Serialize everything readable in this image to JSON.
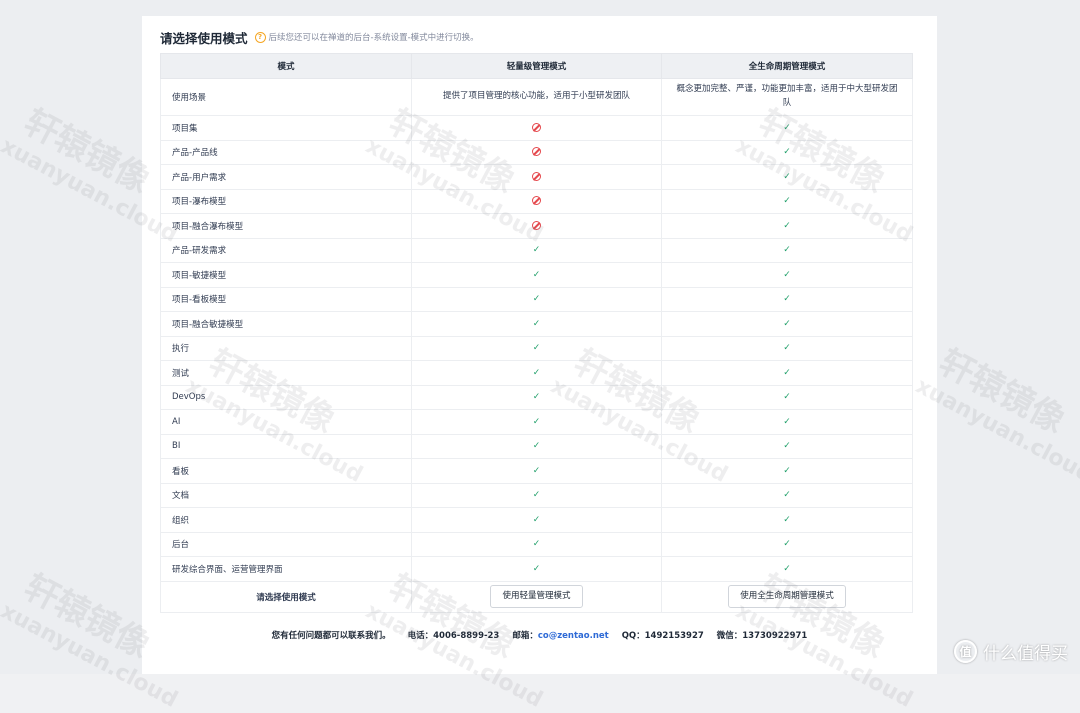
{
  "header": {
    "title": "请选择使用模式",
    "info_icon": "?",
    "hint": "后续您还可以在禅道的后台-系统设置-模式中进行切换。"
  },
  "table": {
    "columns": [
      "模式",
      "轻量级管理模式",
      "全生命周期管理模式"
    ],
    "scene": {
      "label": "使用场景",
      "light": "提供了项目管理的核心功能，适用于小型研发团队",
      "full": "概念更加完整、严谨，功能更加丰富，适用于中大型研发团队"
    },
    "rows": [
      {
        "feature": "项目集",
        "light": "no",
        "full": "yes"
      },
      {
        "feature": "产品-产品线",
        "light": "no",
        "full": "yes"
      },
      {
        "feature": "产品-用户需求",
        "light": "no",
        "full": "yes"
      },
      {
        "feature": "项目-瀑布模型",
        "light": "no",
        "full": "yes"
      },
      {
        "feature": "项目-融合瀑布模型",
        "light": "no",
        "full": "yes"
      },
      {
        "feature": "产品-研发需求",
        "light": "yes",
        "full": "yes"
      },
      {
        "feature": "项目-敏捷模型",
        "light": "yes",
        "full": "yes"
      },
      {
        "feature": "项目-看板模型",
        "light": "yes",
        "full": "yes"
      },
      {
        "feature": "项目-融合敏捷模型",
        "light": "yes",
        "full": "yes"
      },
      {
        "feature": "执行",
        "light": "yes",
        "full": "yes"
      },
      {
        "feature": "测试",
        "light": "yes",
        "full": "yes"
      },
      {
        "feature": "DevOps",
        "light": "yes",
        "full": "yes"
      },
      {
        "feature": "AI",
        "light": "yes",
        "full": "yes"
      },
      {
        "feature": "BI",
        "light": "yes",
        "full": "yes"
      },
      {
        "feature": "看板",
        "light": "yes",
        "full": "yes"
      },
      {
        "feature": "文档",
        "light": "yes",
        "full": "yes"
      },
      {
        "feature": "组织",
        "light": "yes",
        "full": "yes"
      },
      {
        "feature": "后台",
        "light": "yes",
        "full": "yes"
      },
      {
        "feature": "研发综合界面、运营管理界面",
        "light": "yes",
        "full": "yes"
      }
    ],
    "footer": {
      "label": "请选择使用模式",
      "light_button": "使用轻量管理模式",
      "full_button": "使用全生命周期管理模式"
    }
  },
  "contact": {
    "intro": "您有任何问题都可以联系我们。",
    "phone": "电话：4006-8899-23",
    "email_label": "邮箱：",
    "email": "co@zentao.net",
    "qq": "QQ：1492153927",
    "wechat": "微信：13730922971"
  },
  "watermark": {
    "zh": "轩辕镜像",
    "en": "xuanyuan.cloud"
  },
  "site_logo": {
    "mark": "值",
    "text": "什么值得买"
  },
  "colors": {
    "check": "#22a06b",
    "ban": "#e5484d",
    "hint_icon": "#f5a623",
    "email": "#2e6ad6"
  }
}
